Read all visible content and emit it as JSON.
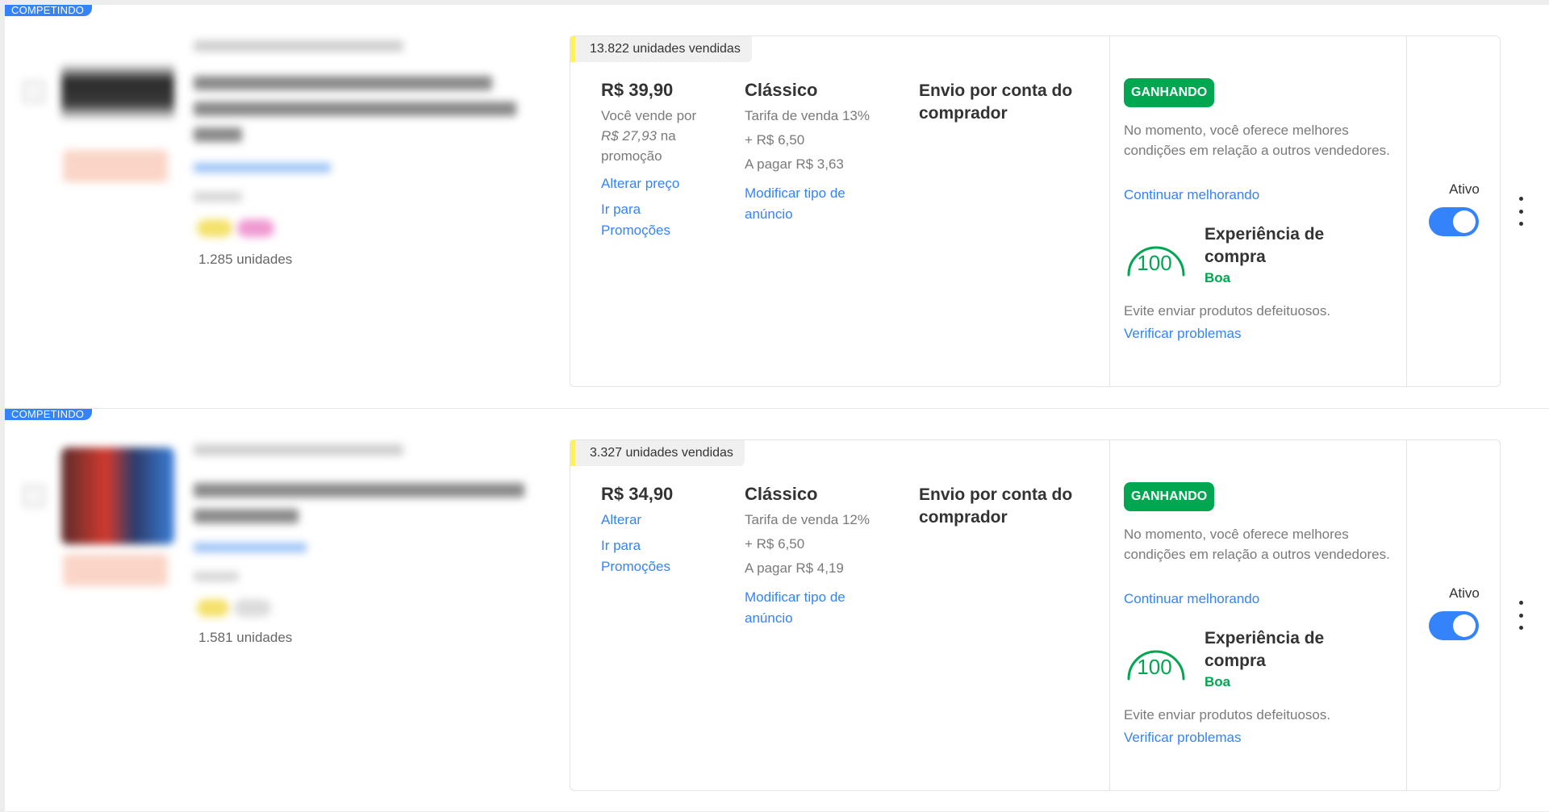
{
  "listings": [
    {
      "ribbon": "COMPETINDO",
      "units_available": "1.285 unidades",
      "sold_badge": "13.822 unidades vendidas",
      "price": "R$ 39,90",
      "price_note_1": "Você vende por",
      "price_note_promo": "R$ 27,93",
      "price_note_2": "na promoção",
      "change_price_link": "Alterar preço",
      "promotions_link": "Ir para Promoções",
      "listing_type": "Clássico",
      "fee_line": "Tarifa de venda 13%",
      "fixed_fee": "+ R$ 6,50",
      "to_pay": "A pagar R$ 3,63",
      "modify_type_link": "Modificar tipo de anúncio",
      "shipping": "Envio por conta do comprador",
      "status": "GANHANDO",
      "status_desc": "No momento, você oferece melhores condições em relação a outros vendedores.",
      "improve_link": "Continuar melhorando",
      "exp_score": "100",
      "exp_title": "Experiência de compra",
      "exp_grade": "Boa",
      "exp_desc": "Evite enviar produtos defeituosos.",
      "check_link": "Verificar problemas",
      "state_label": "Ativo"
    },
    {
      "ribbon": "COMPETINDO",
      "units_available": "1.581 unidades",
      "sold_badge": "3.327 unidades vendidas",
      "price": "R$ 34,90",
      "change_price_link": "Alterar",
      "promotions_link": "Ir para Promoções",
      "listing_type": "Clássico",
      "fee_line": "Tarifa de venda 12%",
      "fixed_fee": "+ R$ 6,50",
      "to_pay": "A pagar R$ 4,19",
      "modify_type_link": "Modificar tipo de anúncio",
      "shipping": "Envio por conta do comprador",
      "status": "GANHANDO",
      "status_desc": "No momento, você oferece melhores condições em relação a outros vendedores.",
      "improve_link": "Continuar melhorando",
      "exp_score": "100",
      "exp_title": "Experiência de compra",
      "exp_grade": "Boa",
      "exp_desc": "Evite enviar produtos defeituosos.",
      "check_link": "Verificar problemas",
      "state_label": "Ativo"
    }
  ],
  "colors": {
    "accent": "#3483fa",
    "success": "#00a650",
    "badge_stripe": "#fff159"
  },
  "icons": [
    "kebab-menu-icon",
    "score-gauge-icon"
  ]
}
